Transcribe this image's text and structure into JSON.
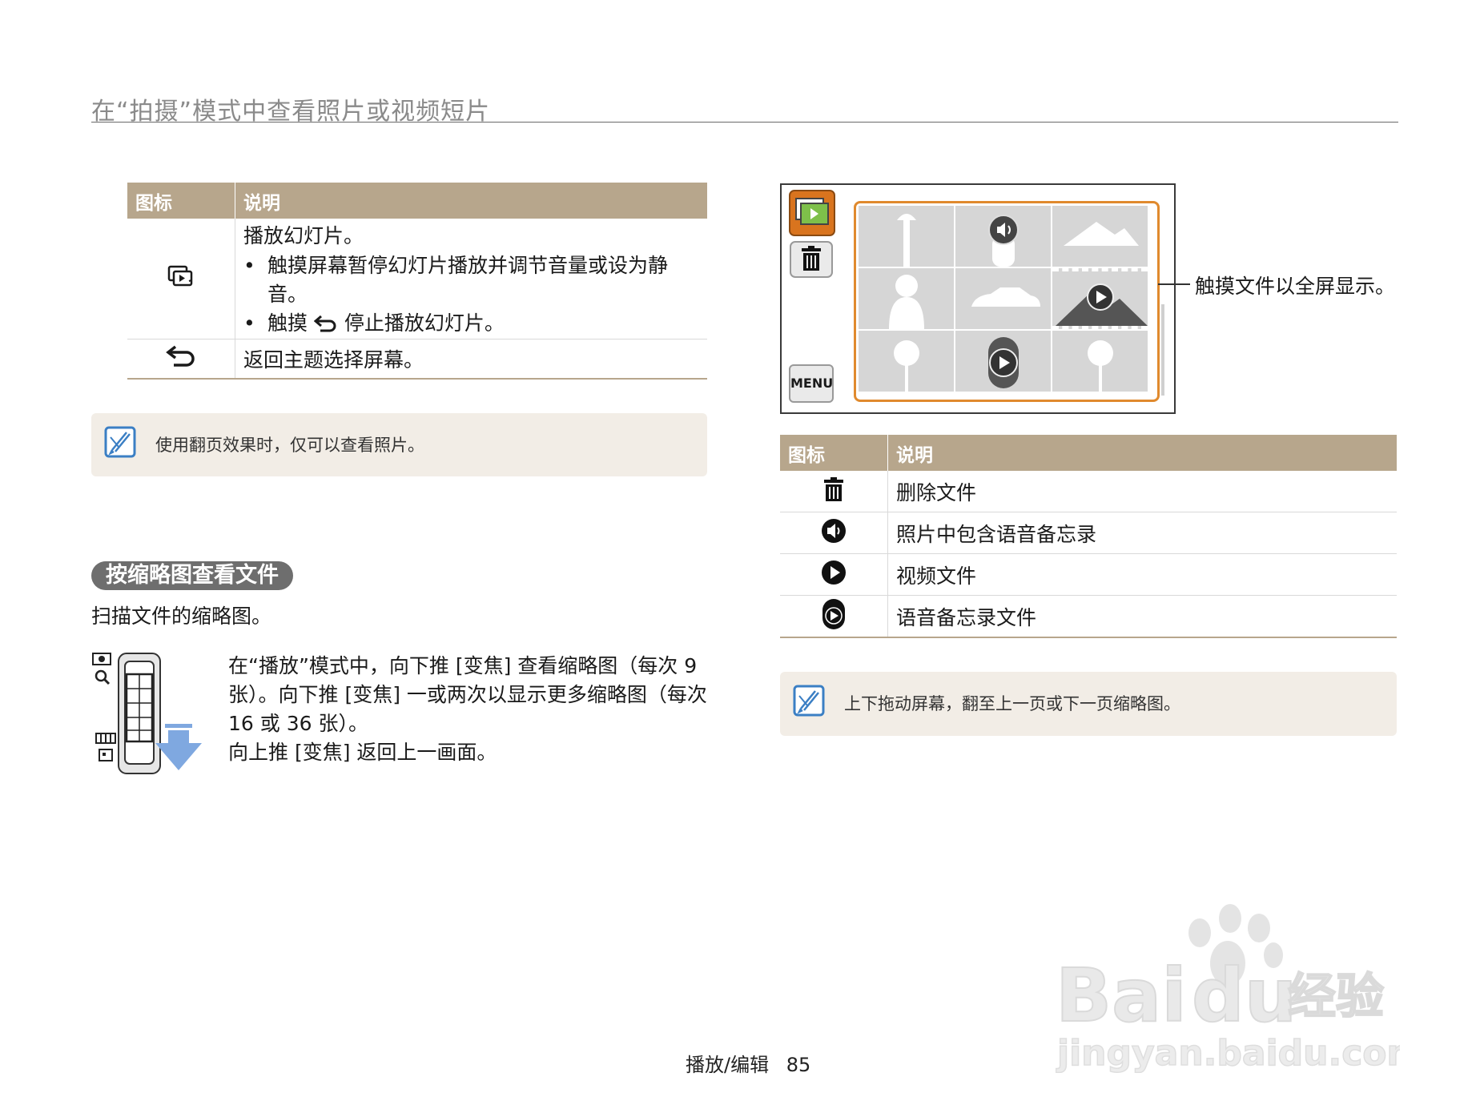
{
  "header": {
    "title": "在“拍摄”模式中查看照片或视频短片"
  },
  "table1": {
    "col_icon": "图标",
    "col_desc": "说明",
    "rows": [
      {
        "icon": "slideshow-icon",
        "title": "播放幻灯片。",
        "bullet1": "触摸屏幕暂停幻灯片播放并调节音量或设为静音。",
        "bullet2_pre": "触摸",
        "bullet2_icon": "back-icon",
        "bullet2_post": "停止播放幻灯片。"
      },
      {
        "icon": "back-icon",
        "desc": "返回主题选择屏幕。"
      }
    ]
  },
  "note1": {
    "icon": "note-icon",
    "text": "使用翻页效果时，仅可以查看照片。"
  },
  "section": {
    "title": "按缩略图查看文件",
    "subtitle": "扫描文件的缩略图。"
  },
  "zoom_instructions": {
    "line1": "在“播放”模式中，向下推 [变焦] 查看缩略图（每次 9 张）。向下推 [变焦] 一或两次以显示更多缩略图（每次 16 或 36 张）。",
    "line2": "向上推 [变焦] 返回上一画面。"
  },
  "screen": {
    "menu_button": "MENU",
    "callout": "触摸文件以全屏显示。"
  },
  "table2": {
    "col_icon": "图标",
    "col_desc": "说明",
    "rows": [
      {
        "icon": "trash-icon",
        "desc": "删除文件"
      },
      {
        "icon": "voice-memo-icon",
        "desc": "照片中包含语音备忘录"
      },
      {
        "icon": "video-play-icon",
        "desc": "视频文件"
      },
      {
        "icon": "voice-file-icon",
        "desc": "语音备忘录文件"
      }
    ]
  },
  "note2": {
    "icon": "note-icon",
    "text": "上下拖动屏幕，翻至上一页或下一页缩略图。"
  },
  "footer": {
    "section": "播放/编辑",
    "page": "85"
  },
  "watermark": {
    "brand": "Bai du 经验",
    "url": "jingyan.baidu.com"
  },
  "colors": {
    "table_header": "#b7a68c",
    "note_bg": "#f2ede6",
    "accent_orange": "#e08a2e",
    "pill": "#6e6e6e"
  }
}
